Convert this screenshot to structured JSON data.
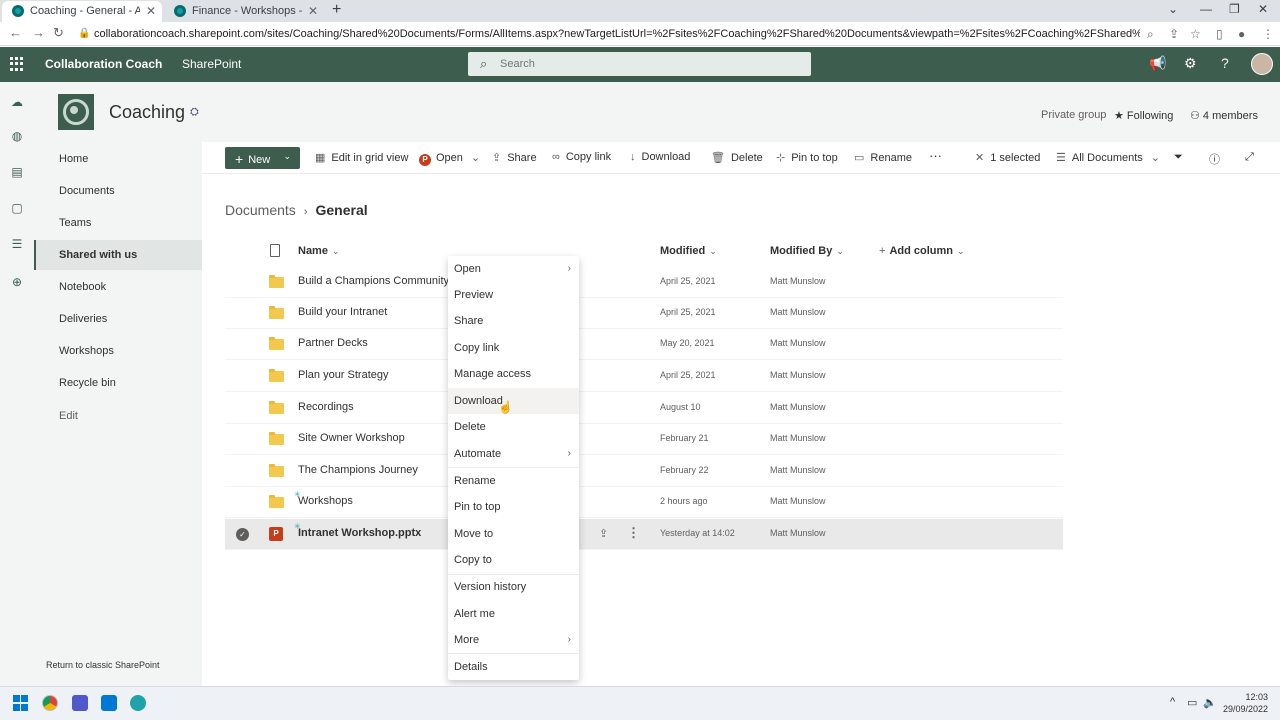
{
  "browser": {
    "tabs": [
      {
        "title": "Coaching - General - All Docume",
        "active": true
      },
      {
        "title": "Finance - Workshops - All Docum",
        "active": false
      }
    ],
    "url": "collaborationcoach.sharepoint.com/sites/Coaching/Shared%20Documents/Forms/AllItems.aspx?newTargetListUrl=%2Fsites%2FCoaching%2FShared%20Documents&viewpath=%2Fsites%2FCoaching%2FShared%20Documents%2FForms%2FAllItems.aspx&viewid=..."
  },
  "suite": {
    "org_name": "Collaboration Coach",
    "app_name": "SharePoint",
    "search_placeholder": "Search",
    "brand_color": "#3d5d4e"
  },
  "site": {
    "title": "Coaching",
    "group_type": "Private group",
    "following_label": "Following",
    "members_label": "4 members"
  },
  "leftnav": {
    "items": [
      "Home",
      "Documents",
      "Teams",
      "Shared with us",
      "Notebook",
      "Deliveries",
      "Workshops",
      "Recycle bin"
    ],
    "active_index": 3,
    "edit_label": "Edit",
    "classic_link": "Return to classic SharePoint"
  },
  "commandbar": {
    "new_label": "New",
    "grid_label": "Edit in grid view",
    "open_label": "Open",
    "share_label": "Share",
    "copylink_label": "Copy link",
    "download_label": "Download",
    "delete_label": "Delete",
    "pin_label": "Pin to top",
    "rename_label": "Rename",
    "more_label": "···",
    "selected_label": "1 selected",
    "view_label": "All Documents"
  },
  "breadcrumb": {
    "root": "Documents",
    "current": "General"
  },
  "table": {
    "columns": {
      "name": "Name",
      "modified": "Modified",
      "modified_by": "Modified By",
      "add_column": "Add column"
    },
    "rows": [
      {
        "name": "Build a Champions Community",
        "modified": "April 25, 2021",
        "by": "Matt Munslow"
      },
      {
        "name": "Build your Intranet",
        "modified": "April 25, 2021",
        "by": "Matt Munslow"
      },
      {
        "name": "Partner Decks",
        "modified": "May 20, 2021",
        "by": "Matt Munslow"
      },
      {
        "name": "Plan your Strategy",
        "modified": "April 25, 2021",
        "by": "Matt Munslow"
      },
      {
        "name": "Recordings",
        "modified": "August 10",
        "by": "Matt Munslow"
      },
      {
        "name": "Site Owner Workshop",
        "modified": "February 21",
        "by": "Matt Munslow"
      },
      {
        "name": "The Champions Journey",
        "modified": "February 22",
        "by": "Matt Munslow"
      },
      {
        "name": "Workshops",
        "modified": "2 hours ago",
        "by": "Matt Munslow"
      },
      {
        "name": "Intranet Workshop.pptx",
        "modified": "Yesterday at 14:02",
        "by": "Matt Munslow"
      }
    ]
  },
  "contextmenu": {
    "items": [
      "Open",
      "Preview",
      "Share",
      "Copy link",
      "Manage access",
      "Download",
      "Delete",
      "Automate",
      "Rename",
      "Pin to top",
      "Move to",
      "Copy to",
      "Version history",
      "Alert me",
      "More",
      "Details"
    ],
    "hovered": "Download"
  },
  "taskbar": {
    "time": "12:03",
    "date": "29/09/2022"
  }
}
